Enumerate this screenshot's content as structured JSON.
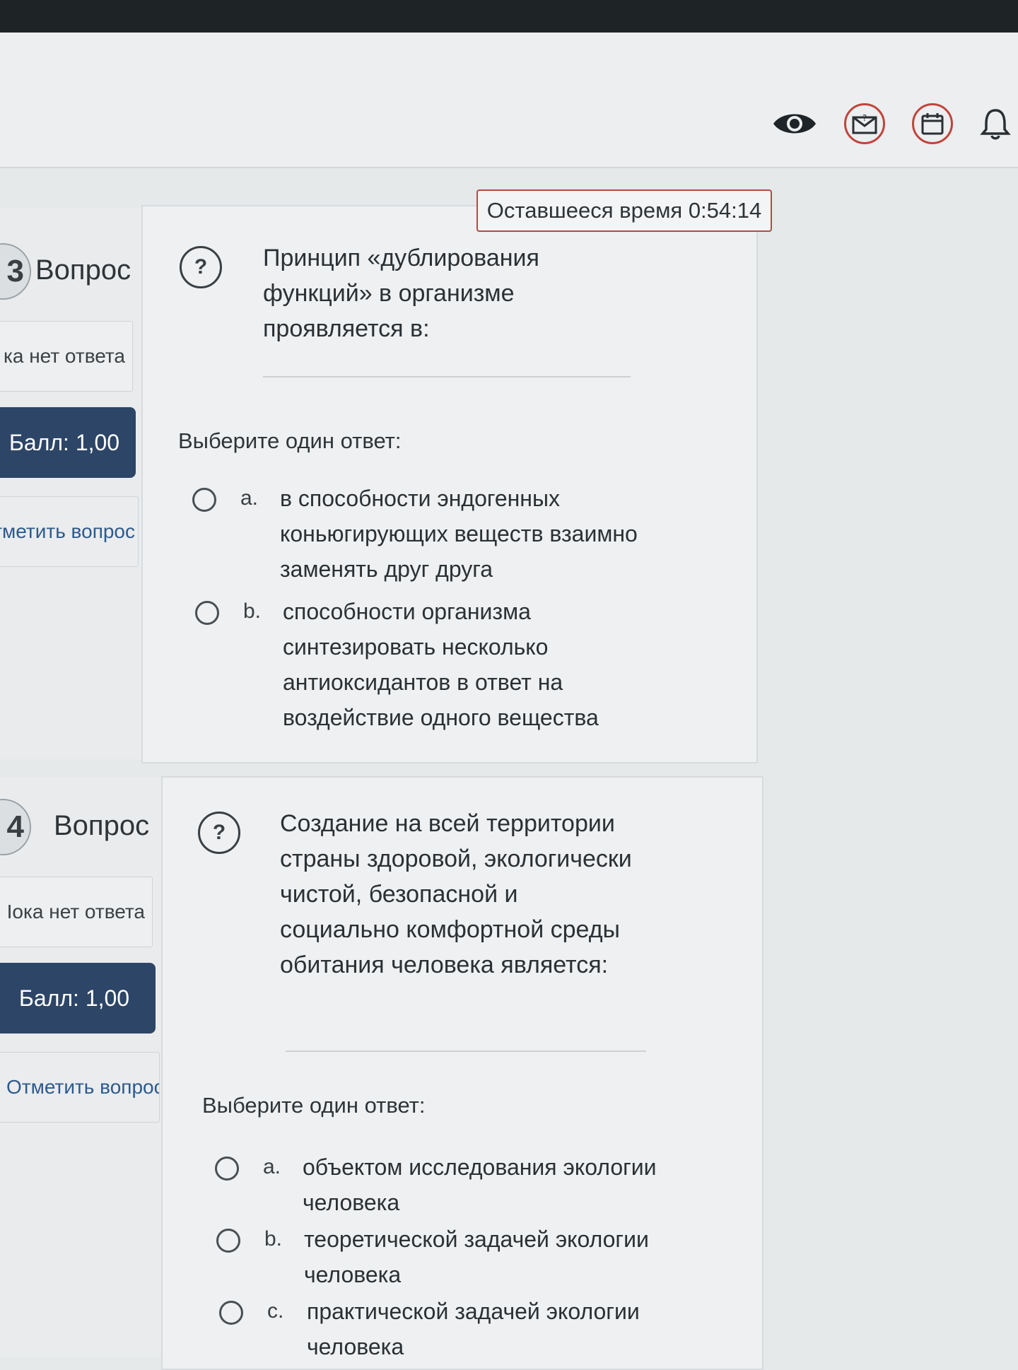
{
  "header": {
    "icons": [
      "eye-icon",
      "mail-question-icon",
      "calendar-icon",
      "bell-icon"
    ],
    "accent_color": "#c1443c"
  },
  "timer": {
    "text": "Оставшееся время 0:54:14"
  },
  "questions": [
    {
      "number": "3",
      "label": "Вопрос",
      "state": "ка нет ответа",
      "grade": "Балл: 1,00",
      "flag": "тметить вопрос",
      "text": "Принцип «дублирования функций» в организме проявляется в:",
      "prompt": "Выберите один ответ:",
      "answers": [
        {
          "letter": "a.",
          "text": "в способности эндогенных коньюгирующих веществ взаимно заменять друг друга"
        },
        {
          "letter": "b.",
          "text": "способности организма синтезировать несколько антиоксидантов в ответ на воздействие одного вещества"
        }
      ]
    },
    {
      "number": "4",
      "label": "Вопрос",
      "state": "Іока нет ответа",
      "grade": "Балл: 1,00",
      "flag": "Отметить вопрос",
      "text": "Создание на всей территории страны здоровой, экологически чистой, безопасной и социально комфортной среды обитания человека является:",
      "prompt": "Выберите один ответ:",
      "answers": [
        {
          "letter": "a.",
          "text": "объектом исследования экологии человека"
        },
        {
          "letter": "b.",
          "text": "теоретической задачей экологии человека"
        },
        {
          "letter": "c.",
          "text": "практической задачей экологии человека"
        }
      ]
    }
  ]
}
